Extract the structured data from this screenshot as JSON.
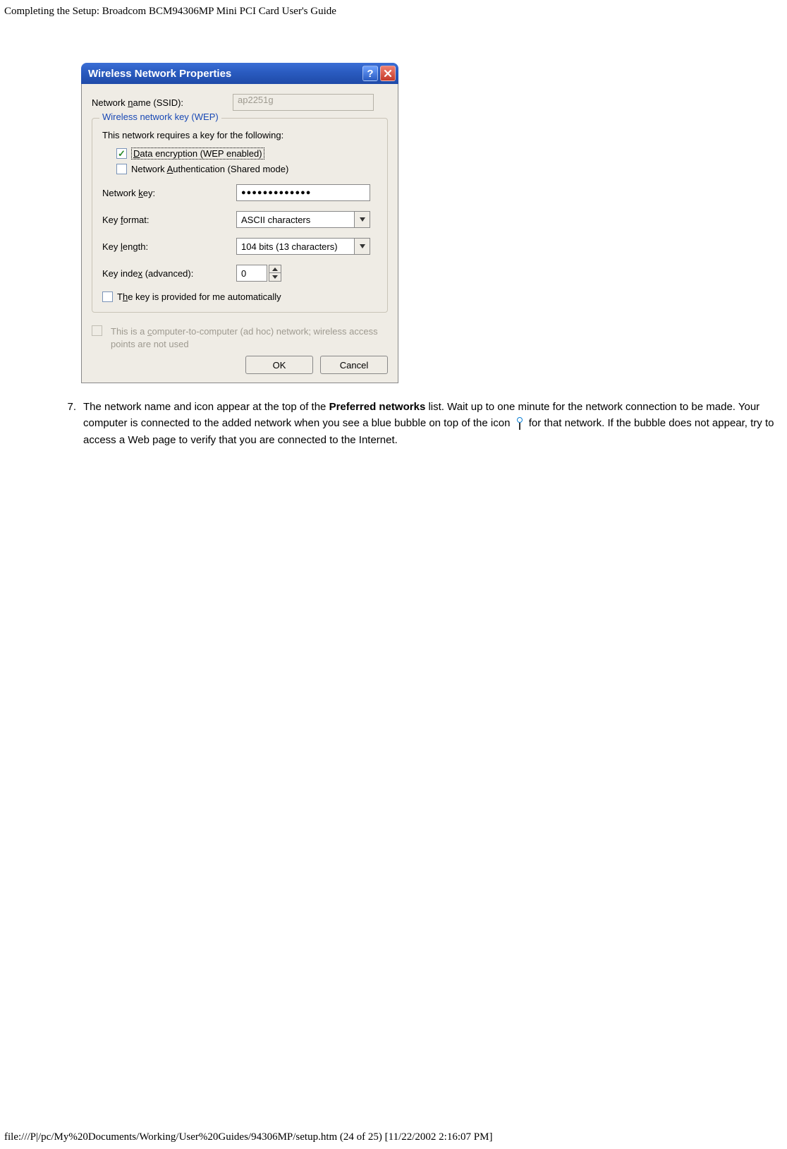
{
  "page": {
    "header": "Completing the Setup: Broadcom BCM94306MP Mini PCI Card User's Guide",
    "footer": "file:///P|/pc/My%20Documents/Working/User%20Guides/94306MP/setup.htm (24 of 25) [11/22/2002 2:16:07 PM]"
  },
  "dialog": {
    "title": "Wireless Network Properties",
    "ssid_label_pre": "Network ",
    "ssid_label_accel": "n",
    "ssid_label_post": "ame (SSID):",
    "ssid_value": "ap2251g",
    "group_legend": "Wireless network key (WEP)",
    "group_desc": "This network requires a key for the following:",
    "chk_data_pre": "",
    "chk_data_accel": "D",
    "chk_data_post": "ata encryption (WEP enabled)",
    "chk_auth_pre": "Network ",
    "chk_auth_accel": "A",
    "chk_auth_post": "uthentication (Shared mode)",
    "key_label_pre": "Network ",
    "key_label_accel": "k",
    "key_label_post": "ey:",
    "key_value": "●●●●●●●●●●●●●",
    "format_label_pre": "Key ",
    "format_label_accel": "f",
    "format_label_post": "ormat:",
    "format_value": "ASCII characters",
    "length_label_pre": "Key ",
    "length_label_accel": "l",
    "length_label_post": "ength:",
    "length_value": "104 bits (13 characters)",
    "index_label_pre": "Key inde",
    "index_label_accel": "x",
    "index_label_post": " (advanced):",
    "index_value": "0",
    "auto_pre": "T",
    "auto_accel": "h",
    "auto_post": "e key is provided for me automatically",
    "adhoc_pre": "This is a ",
    "adhoc_accel": "c",
    "adhoc_post": "omputer-to-computer (ad hoc) network; wireless access points are not used",
    "ok": "OK",
    "cancel": "Cancel"
  },
  "step": {
    "num": "7.",
    "text_before_bold": "The network name and icon appear at the top of the ",
    "bold": "Preferred networks",
    "text_after_bold_1": " list. Wait up to one minute for the network connection to be made. Your computer is connected to the added network when you see a blue bubble on top of the icon ",
    "text_after_icon": " for that network. If the bubble does not appear, try to access a Web page to verify that you are connected to the Internet."
  }
}
